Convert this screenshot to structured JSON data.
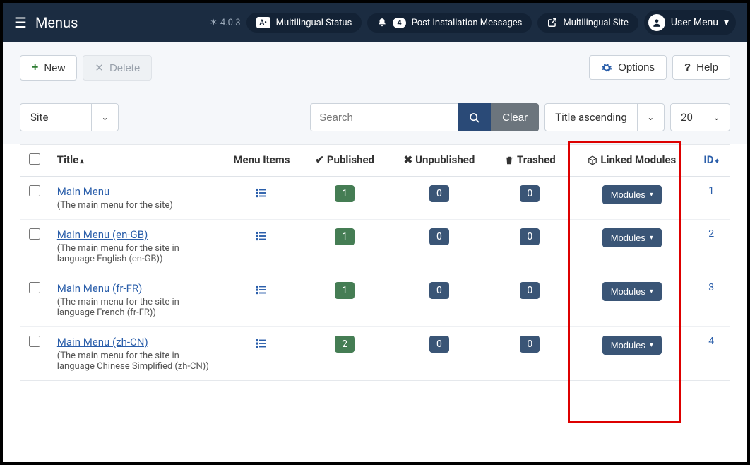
{
  "header": {
    "title": "Menus",
    "version": "4.0.3",
    "multilingual_status": "Multilingual Status",
    "notif_count": "4",
    "post_install": "Post Installation Messages",
    "multilingual_site": "Multilingual Site",
    "user_menu": "User Menu"
  },
  "toolbar": {
    "new": "New",
    "delete": "Delete",
    "options": "Options",
    "help": "Help"
  },
  "filters": {
    "client": "Site",
    "search_placeholder": "Search",
    "clear": "Clear",
    "sort": "Title ascending",
    "limit": "20"
  },
  "columns": {
    "title": "Title",
    "menu_items": "Menu Items",
    "published": "Published",
    "unpublished": "Unpublished",
    "trashed": "Trashed",
    "linked_modules": "Linked Modules",
    "id": "ID"
  },
  "modules_label": "Modules",
  "rows": [
    {
      "title": "Main Menu",
      "desc": "(The main menu for the site)",
      "published": "1",
      "unpublished": "0",
      "trashed": "0",
      "id": "1"
    },
    {
      "title": "Main Menu (en-GB)",
      "desc": "(The main menu for the site in language English (en-GB))",
      "published": "1",
      "unpublished": "0",
      "trashed": "0",
      "id": "2"
    },
    {
      "title": "Main Menu (fr-FR)",
      "desc": "(The main menu for the site in language French (fr-FR))",
      "published": "1",
      "unpublished": "0",
      "trashed": "0",
      "id": "3"
    },
    {
      "title": "Main Menu (zh-CN)",
      "desc": "(The main menu for the site in language Chinese Simplified (zh-CN))",
      "published": "2",
      "unpublished": "0",
      "trashed": "0",
      "id": "4"
    }
  ]
}
